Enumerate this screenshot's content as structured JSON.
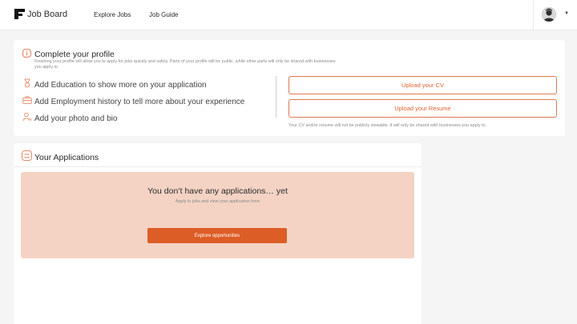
{
  "header": {
    "brand_name": "Job Board",
    "nav": [
      {
        "label": "Explore Jobs"
      },
      {
        "label": "Job Guide"
      }
    ],
    "avatar_icon": "user-avatar-icon",
    "menu_icon": "chevron-down-icon"
  },
  "profile": {
    "title": "Complete your profile",
    "description": "Finishing your profile will allow you to apply for jobs quickly and safely. Parts of your profile will be public, while other parts will only be shared with businesses you apply to",
    "items": [
      {
        "label": "Add Education to show more on your application",
        "icon": "graduation-icon"
      },
      {
        "label": "Add Employment history to tell more about your experience",
        "icon": "briefcase-icon"
      },
      {
        "label": "Add your photo and bio",
        "icon": "person-icon"
      }
    ],
    "upload_cv_label": "Upload your CV",
    "upload_resume_label": "Upload your Resume",
    "privacy_note": "Your CV and/or resume will not be publicly viewable. It will only be shared with businesses you apply to."
  },
  "applications": {
    "title": "Your Applications",
    "empty_title": "You don’t have any applications… yet",
    "empty_subtitle": "Apply to jobs and view your application here",
    "explore_button": "Explore opportunities"
  },
  "colors": {
    "accent": "#dd5d26",
    "accent_outline": "#e07a50",
    "empty_panel": "#f4d3c4",
    "background": "#f5f5f5"
  }
}
